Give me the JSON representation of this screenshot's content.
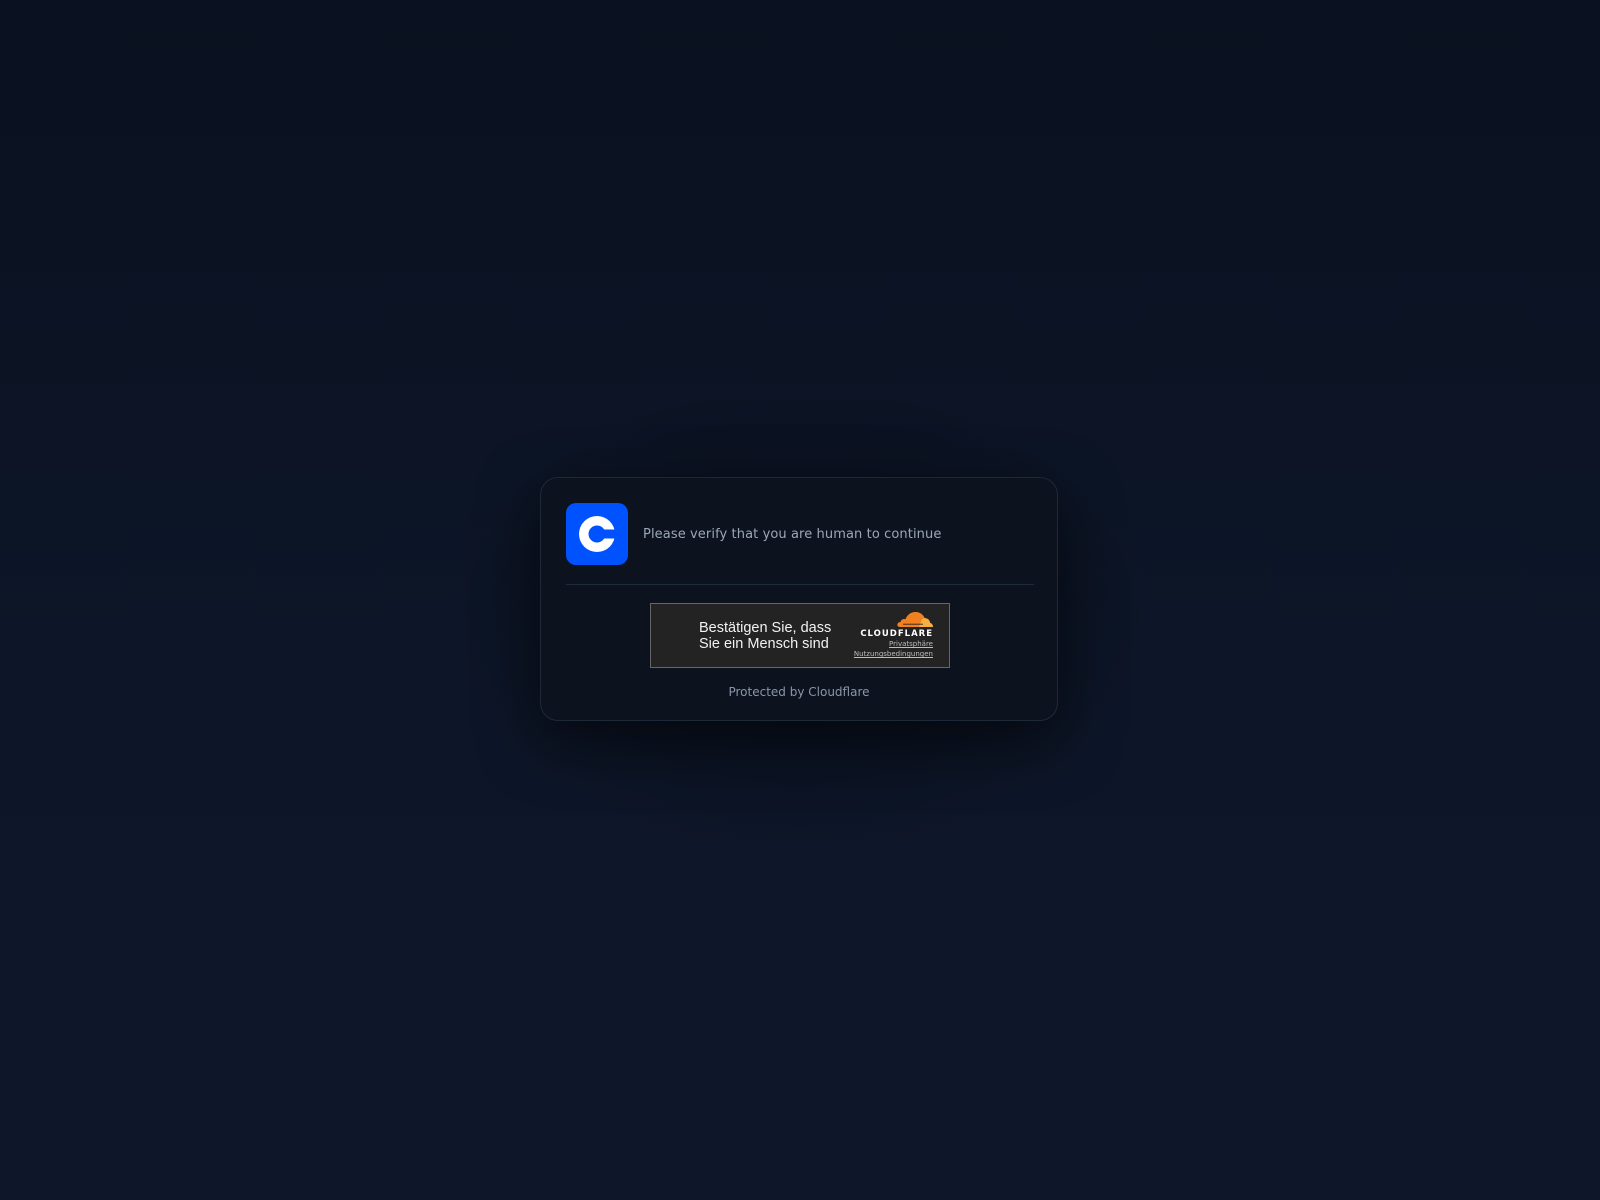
{
  "header": {
    "message": "Please verify that you are human to continue",
    "logo_icon": "coinbase-logo-icon",
    "logo_color": "#0052ff"
  },
  "turnstile": {
    "label_line1": "Bestätigen Sie, dass",
    "label_line2": "Sie ein Mensch sind",
    "brand": "CLOUDFLARE",
    "brand_icon": "cloudflare-cloud-icon",
    "brand_color": "#f38020",
    "privacy_link": "Privatsphäre",
    "terms_link": "Nutzungsbedingungen"
  },
  "footer": {
    "text": "Protected by Cloudflare"
  }
}
